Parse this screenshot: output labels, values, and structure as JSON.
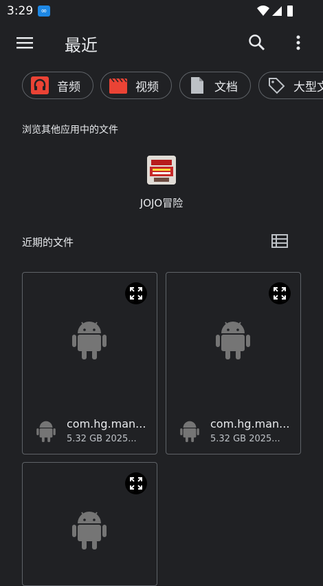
{
  "status_bar": {
    "time": "3:29"
  },
  "app_bar": {
    "title": "最近"
  },
  "chips": [
    {
      "label": "音频",
      "icon": "headphones-icon"
    },
    {
      "label": "视频",
      "icon": "movie-icon"
    },
    {
      "label": "文档",
      "icon": "document-icon"
    },
    {
      "label": "大型文",
      "icon": "tag-icon"
    }
  ],
  "browse_section": {
    "title": "浏览其他应用中的文件",
    "apps": [
      {
        "label": "JOJO冒险"
      }
    ]
  },
  "recent_section": {
    "title": "近期的文件",
    "files": [
      {
        "name": "com.hg.man...",
        "meta": "5.32 GB 2025..."
      },
      {
        "name": "com.hg.man...",
        "meta": "5.32 GB 2025..."
      },
      {
        "name": "",
        "meta": ""
      }
    ]
  },
  "colors": {
    "background": "#202124",
    "audio_icon": "#ea4335",
    "video_icon": "#ea4335",
    "doc_icon": "#bdc1c6"
  }
}
